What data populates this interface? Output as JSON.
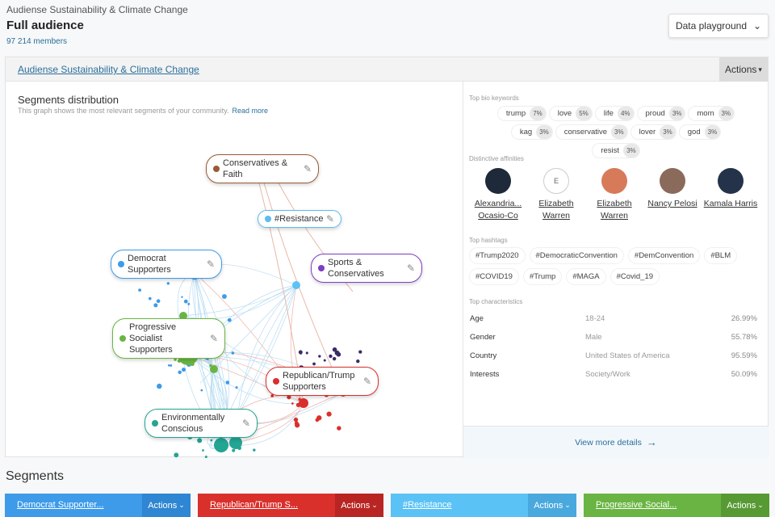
{
  "header": {
    "breadcrumb": "Audiense Sustainability & Climate Change",
    "title": "Full audience",
    "members": "97 214 members",
    "playground": "Data playground"
  },
  "card": {
    "title": "Audiense Sustainability & Climate Change",
    "actions": "Actions",
    "segments_title": "Segments distribution",
    "segments_sub": "This graph shows the most relevant segments of your community.",
    "read_more": "Read more"
  },
  "graph_labels": [
    {
      "text": "Conservatives & Faith",
      "color": "#9a5a35"
    },
    {
      "text": "#Resistance",
      "color": "#5bbcf0"
    },
    {
      "text": "Democrat Supporters",
      "color": "#3d9be9"
    },
    {
      "text": "Sports & Conservatives",
      "color": "#7b3fc4"
    },
    {
      "text": "Progressive Socialist Supporters",
      "color": "#6ab443"
    },
    {
      "text": "Republican/Trump Supporters",
      "color": "#d9302c"
    },
    {
      "text": "Environmentally Conscious",
      "color": "#23a593"
    }
  ],
  "right": {
    "keywords_title": "Top bio keywords",
    "keywords": [
      {
        "w": "trump",
        "p": "7%"
      },
      {
        "w": "love",
        "p": "5%"
      },
      {
        "w": "life",
        "p": "4%"
      },
      {
        "w": "proud",
        "p": "3%"
      },
      {
        "w": "mom",
        "p": "3%"
      },
      {
        "w": "kag",
        "p": "3%"
      },
      {
        "w": "conservative",
        "p": "3%"
      },
      {
        "w": "lover",
        "p": "3%"
      },
      {
        "w": "god",
        "p": "3%"
      },
      {
        "w": "resist",
        "p": "3%"
      }
    ],
    "affinities_title": "Distinctive affinities",
    "affinities": [
      {
        "name": "Alexandria... Ocasio-Co",
        "initial": ""
      },
      {
        "name": "Elizabeth Warren",
        "initial": "E"
      },
      {
        "name": "Elizabeth Warren",
        "initial": ""
      },
      {
        "name": "Nancy Pelosi",
        "initial": ""
      },
      {
        "name": "Kamala Harris",
        "initial": ""
      }
    ],
    "hashtags_title": "Top hashtags",
    "hashtags": [
      "#Trump2020",
      "#DemocraticConvention",
      "#DemConvention",
      "#BLM",
      "#COVID19",
      "#Trump",
      "#MAGA",
      "#Covid_19"
    ],
    "chars_title": "Top characteristics",
    "chars": [
      {
        "k": "Age",
        "v": "18-24",
        "p": "26.99%"
      },
      {
        "k": "Gender",
        "v": "Male",
        "p": "55.78%"
      },
      {
        "k": "Country",
        "v": "United States of America",
        "p": "95.59%"
      },
      {
        "k": "Interests",
        "v": "Society/Work",
        "p": "50.09%"
      }
    ],
    "more": "View more details"
  },
  "segments": {
    "title": "Segments",
    "items": [
      {
        "name": "Democrat Supporter...",
        "actions": "Actions",
        "color": "#3d9be9",
        "dark": "#2f86d2"
      },
      {
        "name": "Republican/Trump S...",
        "actions": "Actions",
        "color": "#d9302c",
        "dark": "#b82522"
      },
      {
        "name": "#Resistance",
        "actions": "Actions",
        "color": "#5bc2f5",
        "dark": "#49a9de"
      },
      {
        "name": "Progressive Social...",
        "actions": "Actions",
        "color": "#6ab443",
        "dark": "#579a34"
      }
    ]
  }
}
